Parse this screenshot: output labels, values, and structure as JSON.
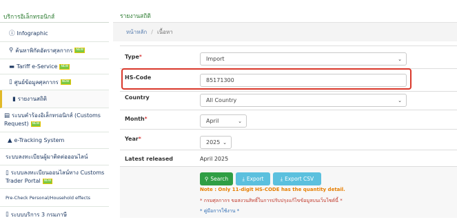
{
  "sidebar": {
    "heading": "บริการอิเล็กทรอนิกส์",
    "items": [
      {
        "icon": "info-icon",
        "glyph": "ⓘ",
        "label": "Infographic",
        "badge": ""
      },
      {
        "icon": "search-icon",
        "glyph": "🔍",
        "label": "ค้นหาพิกัดอัตราศุลกากร",
        "badge": "NEW"
      },
      {
        "icon": "card-icon",
        "glyph": "▬",
        "label": "Tariff e-Service",
        "badge": "NEW"
      },
      {
        "icon": "box-icon",
        "glyph": "▯",
        "label": "ศูนย์ข้อมูลศุลกากร",
        "badge": "NEW"
      },
      {
        "icon": "chart-icon",
        "glyph": "▮",
        "label": "รายงานสถิติ",
        "badge": ""
      },
      {
        "icon": "printer-icon",
        "glyph": "▤",
        "label": "ระบบคำร้องอิเล็กทรอนิกส์ (Customs Request)",
        "badge": "NEW"
      },
      {
        "icon": "tracking-icon",
        "glyph": "🚚",
        "label": "e-Tracking System",
        "badge": ""
      },
      {
        "icon": "",
        "glyph": "",
        "label": "ระบบลงทะเบียนผู้มาติดต่อออนไลน์",
        "badge": ""
      },
      {
        "icon": "box-icon",
        "glyph": "▯",
        "label": "ระบบลงทะเบียนออนไลน์ทาง Customs Trader Portal",
        "badge": "NEW"
      },
      {
        "icon": "",
        "glyph": "",
        "label": "Pre-Check Personal/Household effects",
        "badge": ""
      },
      {
        "icon": "box-icon",
        "glyph": "▯",
        "label": "ระบบบริการ 3 กรมภาษี",
        "badge": ""
      }
    ]
  },
  "main": {
    "title": "รายงานสถิติ",
    "breadcrumb": [
      "หน้าหลัก",
      "เนื้อหา"
    ],
    "form": {
      "type_label": "Type",
      "type_value": "Import",
      "hscode_label": "HS-Code",
      "hscode_value": "85171300",
      "country_label": "Country",
      "country_value": "All Country",
      "month_label": "Month",
      "month_value": "April",
      "year_label": "Year",
      "year_value": "2025",
      "released_label": "Latest released",
      "released_value": "April 2025"
    },
    "buttons": {
      "search": "Search",
      "export": "Export",
      "export_csv": "Export CSV"
    },
    "notes": {
      "note": "Note : Only 11-digit HS-CODE has the quantity detail.",
      "update": "* กรมศุลกากร ขอสงวนสิทธิ์ในการปรับปรุงแก้ไขข้อมูลบนเว็บไซต์นี้ *",
      "manual": "* คู่มือการใช้งาน *"
    },
    "required_mark": "*",
    "colors": {
      "accent_green": "#2e7d32",
      "button_green": "#2f9e44",
      "button_blue": "#5bc0de",
      "highlight": "#d9372a"
    }
  }
}
